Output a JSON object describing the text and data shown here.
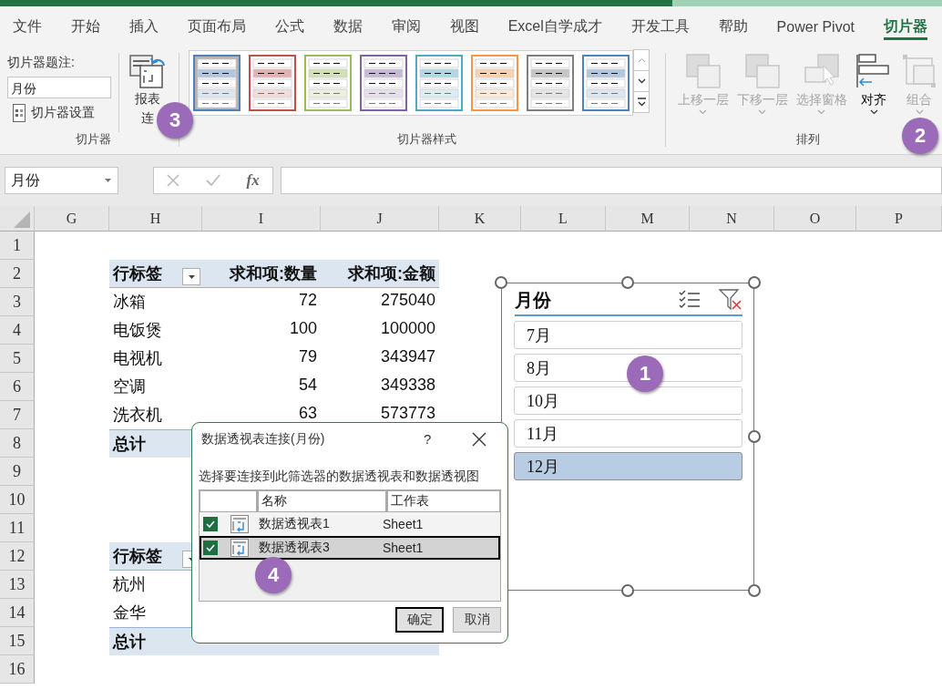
{
  "ribbon": {
    "tabs": [
      {
        "label": "文件",
        "selected": false
      },
      {
        "label": "开始",
        "selected": false
      },
      {
        "label": "插入",
        "selected": false
      },
      {
        "label": "页面布局",
        "selected": false
      },
      {
        "label": "公式",
        "selected": false
      },
      {
        "label": "数据",
        "selected": false
      },
      {
        "label": "审阅",
        "selected": false
      },
      {
        "label": "视图",
        "selected": false
      },
      {
        "label": "Excel自学成才",
        "selected": false
      },
      {
        "label": "开发工具",
        "selected": false
      },
      {
        "label": "帮助",
        "selected": false
      },
      {
        "label": "Power Pivot",
        "selected": false
      },
      {
        "label": "切片器",
        "selected": true
      }
    ],
    "caption_label": "切片器题注:",
    "caption_value": "月份",
    "settings_button": "切片器设置",
    "connections_button": [
      "报表",
      "连"
    ],
    "groups": [
      "切片器",
      "切片器样式",
      "排列"
    ],
    "styles": [
      {
        "color": "#4f81bd",
        "selected": true
      },
      {
        "color": "#c0504d",
        "selected": false
      },
      {
        "color": "#9bbb59",
        "selected": false
      },
      {
        "color": "#8064a2",
        "selected": false
      },
      {
        "color": "#4bacc6",
        "selected": false
      },
      {
        "color": "#f79646",
        "selected": false
      },
      {
        "color": "#7f7f7f",
        "selected": false
      },
      {
        "color": "#4f81bd",
        "selected": false
      }
    ],
    "arrange": [
      {
        "kind": "forward",
        "label": "上移一层",
        "disabled": true
      },
      {
        "kind": "backward",
        "label": "下移一层",
        "disabled": true
      },
      {
        "kind": "pane",
        "label": "选择窗格",
        "disabled": true
      },
      {
        "kind": "align",
        "label": "对齐",
        "disabled": false
      },
      {
        "kind": "group",
        "label": "组合",
        "disabled": true
      }
    ]
  },
  "formula_bar": {
    "name_box": "月份",
    "fx": "fx"
  },
  "sheet": {
    "columns": [
      "G",
      "H",
      "I",
      "J",
      "K",
      "L",
      "M",
      "N",
      "O",
      "P"
    ],
    "rows": [
      "1",
      "2",
      "3",
      "4",
      "5",
      "6",
      "7",
      "8",
      "9",
      "10",
      "11",
      "12",
      "13",
      "14",
      "15",
      "16"
    ]
  },
  "pivot_tables": [
    {
      "header": [
        "行标签",
        "求和项:数量",
        "求和项:金额"
      ],
      "rows": [
        [
          "冰箱",
          "72",
          "275040"
        ],
        [
          "电饭煲",
          "100",
          "100000"
        ],
        [
          "电视机",
          "79",
          "343947"
        ],
        [
          "空调",
          "54",
          "349338"
        ],
        [
          "洗衣机",
          "63",
          "573773"
        ]
      ],
      "total": [
        "总计"
      ]
    },
    {
      "header": [
        "行标签"
      ],
      "rows": [
        [
          "杭州"
        ],
        [
          "金华"
        ]
      ],
      "total": [
        "总计"
      ]
    }
  ],
  "slicer": {
    "title": "月份",
    "items": [
      {
        "label": "7月",
        "selected": false
      },
      {
        "label": "8月",
        "selected": false
      },
      {
        "label": "10月",
        "selected": false
      },
      {
        "label": "11月",
        "selected": false
      },
      {
        "label": "12月",
        "selected": true
      }
    ]
  },
  "dialog": {
    "title": "数据透视表连接(月份)",
    "help": "?",
    "instruction": "选择要连接到此筛选器的数据透视表和数据透视图",
    "columns": [
      "名称",
      "工作表"
    ],
    "rows": [
      {
        "checked": true,
        "name": "数据透视表1",
        "sheet": "Sheet1",
        "selected": false
      },
      {
        "checked": true,
        "name": "数据透视表3",
        "sheet": "Sheet1",
        "selected": true
      }
    ],
    "buttons": [
      "确定",
      "取消"
    ]
  },
  "badges": [
    "1",
    "2",
    "3",
    "4"
  ]
}
